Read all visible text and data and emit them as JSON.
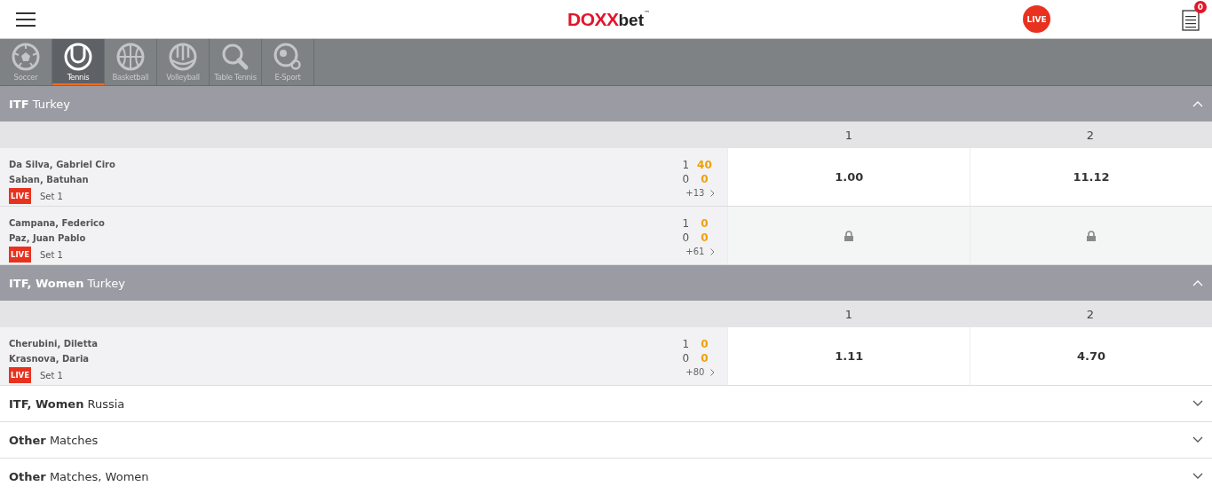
{
  "header": {
    "logo_main": "DOXX",
    "logo_sub": "bet",
    "logo_tm": "™",
    "live_button": "LIVE",
    "betslip_count": "0"
  },
  "sports": [
    {
      "label": "Soccer",
      "kind": "soccer",
      "selected": false
    },
    {
      "label": "Tennis",
      "kind": "tennis",
      "selected": true
    },
    {
      "label": "Basketball",
      "kind": "basketball",
      "selected": false
    },
    {
      "label": "Volleyball",
      "kind": "volleyball",
      "selected": false
    },
    {
      "label": "Table Tennis",
      "kind": "tabletennis",
      "selected": false
    },
    {
      "label": "E-Sport",
      "kind": "esport",
      "selected": false
    }
  ],
  "tournaments": [
    {
      "title": "**ITF** Turkey",
      "expanded": true,
      "columns": [
        "1",
        "2"
      ],
      "matches": [
        {
          "home": "Da Silva, Gabriel Ciro",
          "away": "Saban, Batuhan",
          "live_badge": "LIVE",
          "period": "Set 1",
          "home_sets": "1",
          "home_points": "40",
          "away_sets": "0",
          "away_points": "0",
          "more": "+13",
          "locked": false,
          "odds": [
            "1.00",
            "11.12"
          ]
        },
        {
          "home": "Campana, Federico",
          "away": "Paz, Juan Pablo",
          "live_badge": "LIVE",
          "period": "Set 1",
          "home_sets": "1",
          "home_points": "0",
          "away_sets": "0",
          "away_points": "0",
          "more": "+61",
          "locked": true
        }
      ]
    },
    {
      "title": "**ITF, Women** Turkey",
      "expanded": true,
      "columns": [
        "1",
        "2"
      ],
      "matches": [
        {
          "home": "Cherubini, Diletta",
          "away": "Krasnova, Daria",
          "live_badge": "LIVE",
          "period": "Set 1",
          "home_sets": "1",
          "home_points": "0",
          "away_sets": "0",
          "away_points": "0",
          "more": "+80",
          "locked": false,
          "odds": [
            "1.11",
            "4.70"
          ]
        }
      ]
    },
    {
      "title": "**ITF, Women** Russia",
      "expanded": false
    },
    {
      "title": "**Other** Matches",
      "expanded": false
    },
    {
      "title": "**Other** Matches, Women",
      "expanded": false
    }
  ]
}
